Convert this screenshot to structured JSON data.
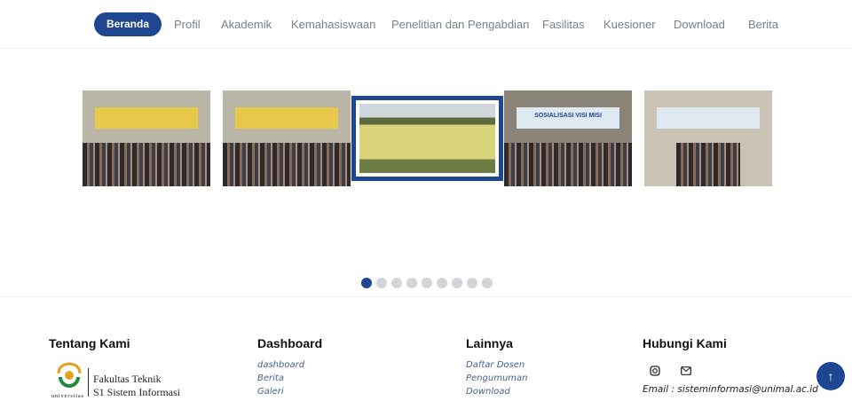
{
  "nav": {
    "items": [
      "Beranda",
      "Profil",
      "Akademik",
      "Kemahasiswaan",
      "Penelitian dan Pengabdian",
      "Fasilitas",
      "Kuesioner",
      "Download",
      "Berita"
    ],
    "active": "Beranda"
  },
  "carousel": {
    "slide_count": 9,
    "active_index": 0,
    "banner_text": "SOSIALISASI VISI MISI"
  },
  "footer": {
    "about": {
      "title": "Tentang Kami",
      "logo_line1": "Fakultas Teknik",
      "logo_line2": "S1 Sistem Informasi",
      "logo_caption": "universitas"
    },
    "dashboard": {
      "title": "Dashboard",
      "links": [
        "dashboard",
        "Berita",
        "Galeri"
      ]
    },
    "others": {
      "title": "Lainnya",
      "links": [
        "Daftar Dosen",
        "Pengumuman",
        "Download"
      ]
    },
    "contact": {
      "title": "Hubungi Kami",
      "email": "Email : sisteminformasi@unimal.ac.id"
    }
  },
  "colors": {
    "primary": "#1f4690"
  }
}
